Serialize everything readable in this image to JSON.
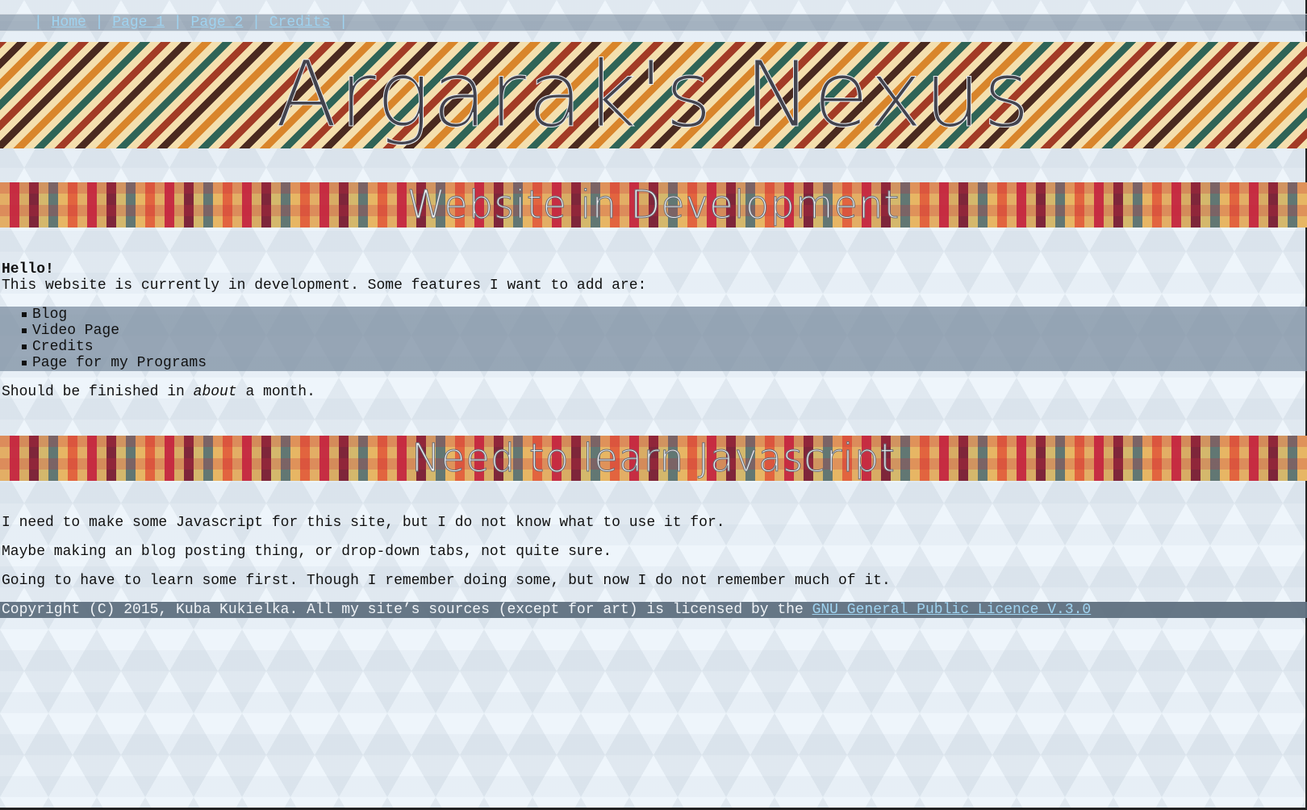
{
  "nav": {
    "separator": "|",
    "links": [
      "Home",
      "Page 1",
      "Page 2",
      "Credits"
    ]
  },
  "header": {
    "title": "Argarak's Nexus"
  },
  "section_dev": {
    "title": "Website in Development",
    "greeting": "Hello!",
    "intro": "This website is currently in development. Some features I want to add are:",
    "features": [
      "Blog",
      "Video Page",
      "Credits",
      "Page for my Programs"
    ],
    "finish_before": "Should be finished in ",
    "finish_em": "about",
    "finish_after": " a month."
  },
  "section_js": {
    "title": "Need to learn Javascript",
    "p1": "I need to make some Javascript for this site, but I do not know what to use it for.",
    "p2": "Maybe making an blog posting thing, or drop-down tabs, not quite sure.",
    "p3": "Going to have to learn some first. Though I remember doing some, but now I do not remember much of it."
  },
  "footer": {
    "text": "Copyright (C) 2015, Kuba Kukielka. All my site’s sources (except for art) is licensed by the ",
    "link_label": "GNU General Public Licence V.3.0"
  },
  "colors": {
    "nav_link": "#9fd3f0",
    "banner_stripes": [
      "#f4dfae",
      "#a33b26",
      "#2f6457",
      "#d9852b",
      "#4a2a20"
    ],
    "footer_bg": "#5f7080"
  }
}
